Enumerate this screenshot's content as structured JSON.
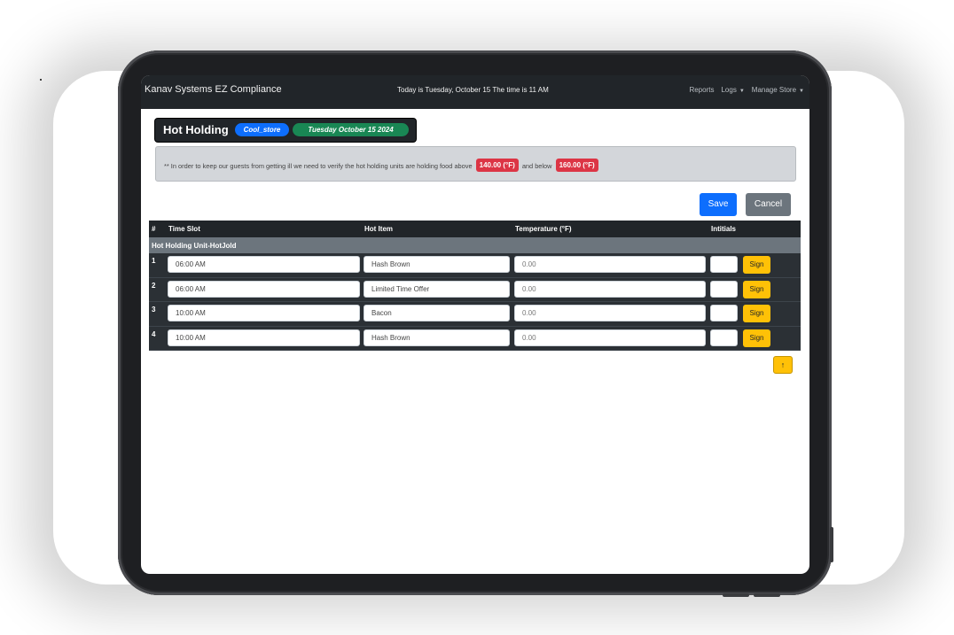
{
  "navbar": {
    "brand": "Kanav Systems EZ Compliance",
    "today": "Today is Tuesday, October 15  The time is 11 AM",
    "links": [
      "Reports",
      "Logs",
      "Manage Store"
    ]
  },
  "header": {
    "title": "Hot Holding",
    "store_badge": "Cool_store",
    "date_badge": "Tuesday October 15 2024"
  },
  "info": {
    "text_before": "** In order to keep our guests from getting ill we need to verify the hot holding units are holding food above",
    "min_temp": "140.00 (°F)",
    "text_middle": "and below",
    "max_temp": "160.00 (°F)"
  },
  "actions": {
    "save": "Save",
    "cancel": "Cancel"
  },
  "table": {
    "columns": {
      "num": "#",
      "time": "Time Slot",
      "item": "Hot Item",
      "temp": "Temperature (°F)",
      "initials": "Intitials"
    },
    "group": "Hot Holding Unit-HotJold",
    "rows": [
      {
        "num": "1",
        "time": "06:00 AM",
        "item": "Hash Brown",
        "temp": "0.00",
        "sign": "Sign"
      },
      {
        "num": "2",
        "time": "06:00 AM",
        "item": "Limited Time Offer",
        "temp": "0.00",
        "sign": "Sign"
      },
      {
        "num": "3",
        "time": "10:00 AM",
        "item": "Bacon",
        "temp": "0.00",
        "sign": "Sign"
      },
      {
        "num": "4",
        "time": "10:00 AM",
        "item": "Hash Brown",
        "temp": "0.00",
        "sign": "Sign"
      }
    ]
  },
  "scroll_top": "↑",
  "colors": {
    "primary": "#0d6efd",
    "success": "#198754",
    "danger": "#dc3545",
    "warning": "#ffc107",
    "dark": "#212529"
  }
}
